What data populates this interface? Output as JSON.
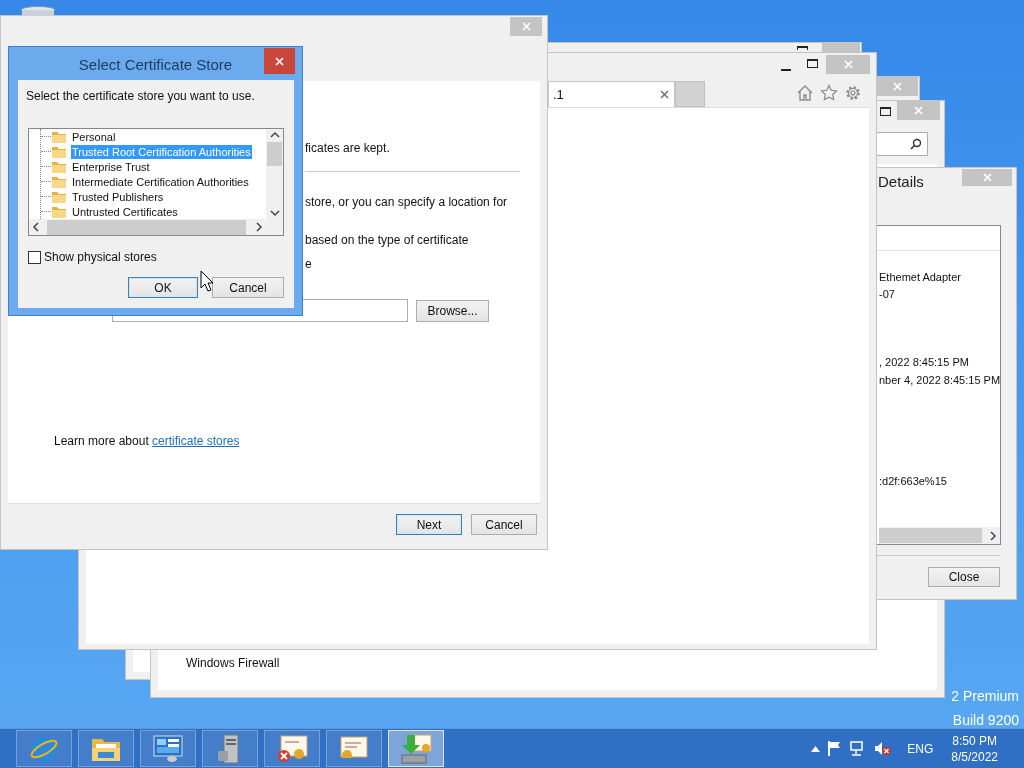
{
  "desktop": {
    "edition_lines": [
      "2 Premium",
      "Build 9200"
    ]
  },
  "control_panel_window": {
    "item": "Windows Firewall"
  },
  "details_window": {
    "title": "Details",
    "lines": [
      "Ethemet Adapter",
      "-07",
      ", 2022 8:45:15 PM",
      "nber 4, 2022 8:45:15 PM",
      ":d2f:663e%15"
    ],
    "close_button": "Close"
  },
  "browser_window": {
    "tabs": [
      {
        "label": ".1",
        "selected": true
      }
    ]
  },
  "import_wizard": {
    "lines": [
      "ficates are kept.",
      "store, or you can specify a location for",
      "based on the type of certificate",
      "e"
    ],
    "browse_button": "Browse...",
    "learn_more": {
      "text": "Learn more about",
      "link": "certificate stores"
    },
    "buttons": [
      {
        "label": "Next",
        "default": true
      },
      {
        "label": "Cancel",
        "default": false
      }
    ]
  },
  "store_dialog": {
    "title": "Select Certificate Store",
    "prompt": "Select the certificate store you want to use.",
    "stores": [
      {
        "label": "Personal",
        "selected": false
      },
      {
        "label": "Trusted Root Certification Authorities",
        "selected": true
      },
      {
        "label": "Enterprise Trust",
        "selected": false
      },
      {
        "label": "Intermediate Certification Authorities",
        "selected": false
      },
      {
        "label": "Trusted Publishers",
        "selected": false
      },
      {
        "label": "Untrusted Certificates",
        "selected": false
      }
    ],
    "show_physical_stores": {
      "label": "Show physical stores",
      "checked": false
    },
    "buttons": [
      {
        "label": "OK",
        "default": true
      },
      {
        "label": "Cancel",
        "default": false
      }
    ]
  },
  "taskbar": {
    "apps": [
      {
        "kind": "browser",
        "selected": false
      },
      {
        "kind": "folder",
        "selected": false
      },
      {
        "kind": "dashboard",
        "selected": false
      },
      {
        "kind": "server",
        "selected": false
      },
      {
        "kind": "certificate_error",
        "selected": false
      },
      {
        "kind": "certificate",
        "selected": false
      },
      {
        "kind": "certificate_import",
        "selected": true
      }
    ],
    "tray": {
      "muted": true,
      "language": "ENG",
      "time": "8:50 PM",
      "date": "8/5/2022"
    }
  }
}
